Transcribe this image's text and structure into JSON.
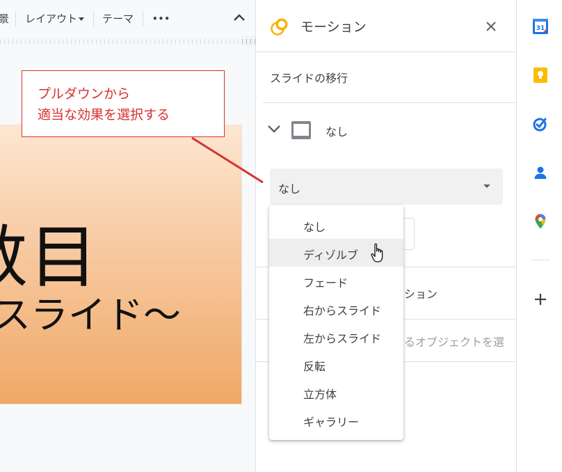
{
  "toolbar": {
    "partial_left_label": "景",
    "layout_label": "レイアウト",
    "theme_label": "テーマ",
    "more_label": "•••"
  },
  "slide": {
    "big_text": "数目",
    "sub_text": "スライド～"
  },
  "callout": {
    "line1": "プルダウンから",
    "line2": "適当な効果を選択する"
  },
  "panel": {
    "title": "モーション",
    "section_title": "スライドの移行",
    "current_transition": "なし",
    "select_value": "なし",
    "behind_object_animation": "ション",
    "behind_hint": "るオブジェクトを選"
  },
  "dropdown": {
    "options": [
      "なし",
      "ディゾルブ",
      "フェード",
      "右からスライド",
      "左からスライド",
      "反転",
      "立方体",
      "ギャラリー"
    ],
    "hovered_index": 1
  },
  "rail": {
    "calendar_day": "31",
    "plus_label": "+"
  },
  "colors": {
    "callout_red": "#d9302f",
    "motion_icon": "#f6b400",
    "calendar_blue": "#1a73e8",
    "keep_yellow": "#fbbc04",
    "tasks_blue": "#1a73e8",
    "contacts_blue": "#1a73e8"
  }
}
